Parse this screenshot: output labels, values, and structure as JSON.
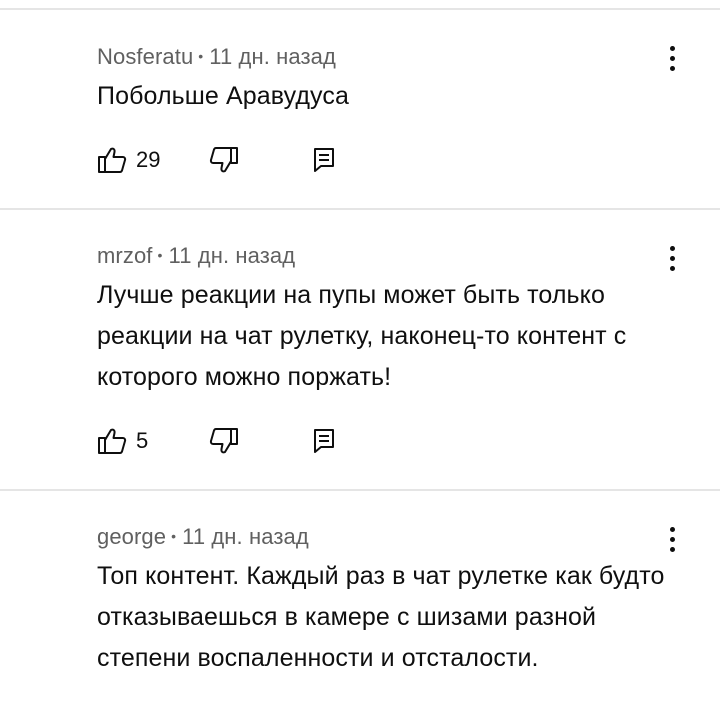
{
  "comments": [
    {
      "author": "Nosferatu",
      "separator": "•",
      "time": "11 дн. назад",
      "text": "Побольше Аравудуса",
      "likes": "29"
    },
    {
      "author": "mrzof",
      "separator": "•",
      "time": "11 дн. назад",
      "text": "Лучше реакции на пупы может быть только реакции на чат рулетку, наконец-то контент с которого можно поржать!",
      "likes": "5"
    },
    {
      "author": "george",
      "separator": "•",
      "time": "11 дн. назад",
      "text": "Топ контент. Каждый раз в чат рулетке как будто отказываешься в камере с шизами разной степени воспаленности и отсталости.",
      "likes": ""
    }
  ],
  "icons": {
    "like": "thumbs-up-icon",
    "dislike": "thumbs-down-icon",
    "reply": "reply-icon",
    "menu": "more-vert-icon"
  },
  "colors": {
    "meta_text": "#606060",
    "body_text": "#0f0f0f",
    "divider": "#e5e5e5"
  }
}
